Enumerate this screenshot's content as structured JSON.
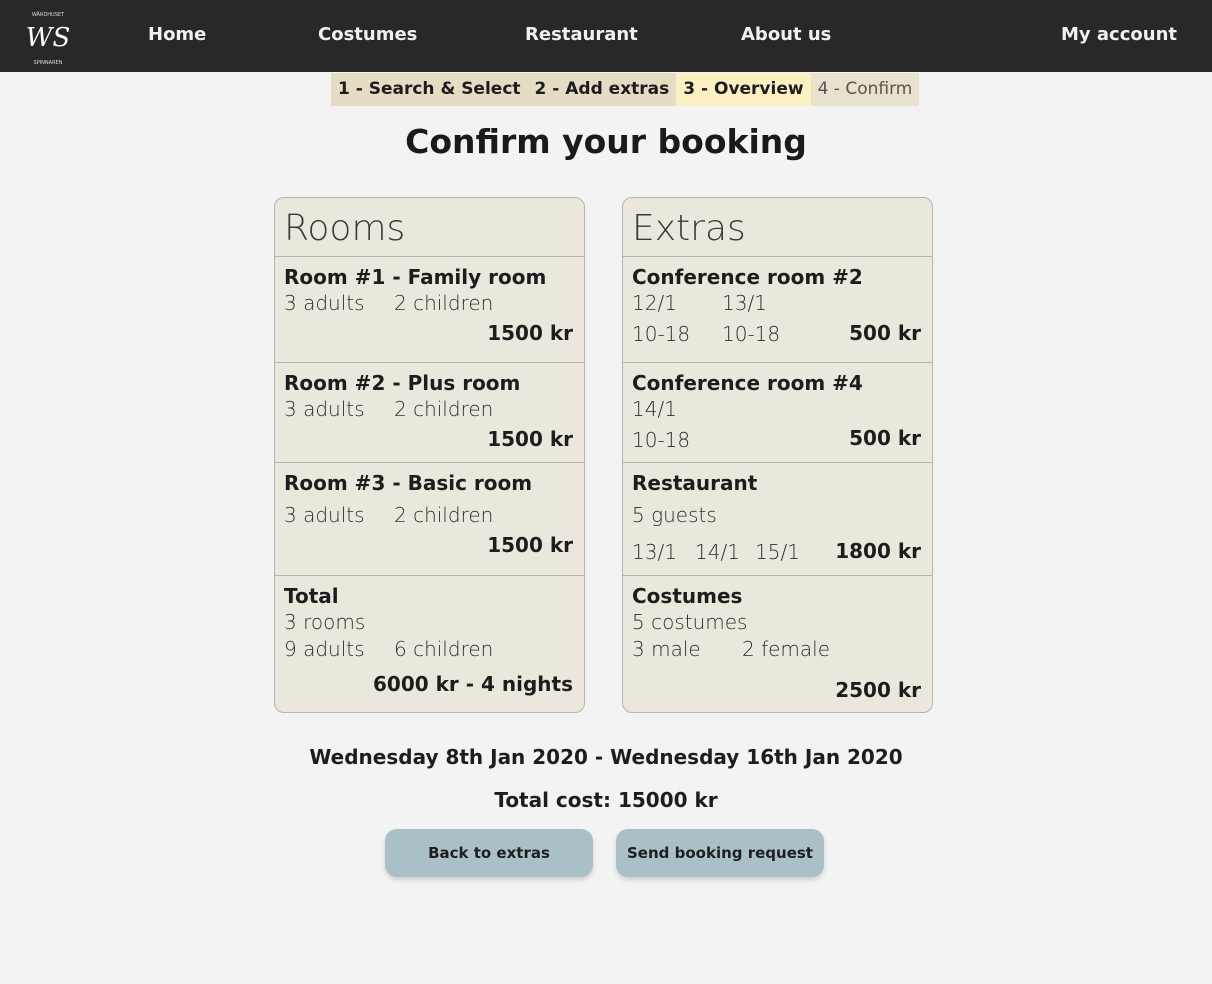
{
  "nav": {
    "logo_text": "WS",
    "logo_top_text": "WÄRDHUSET",
    "logo_bottom_text": "SPINNAREN",
    "links": [
      "Home",
      "Costumes",
      "Restaurant",
      "About us"
    ],
    "account": "My account"
  },
  "steps": [
    "1 - Search & Select",
    "2 - Add extras",
    "3 - Overview",
    "4 - Confirm"
  ],
  "title": "Confirm your booking",
  "rooms": {
    "heading": "Rooms",
    "items": [
      {
        "title": "Room #1 - Family room",
        "adults": "3 adults",
        "children": "2 children",
        "price": "1500 kr"
      },
      {
        "title": "Room #2 - Plus room",
        "adults": "3 adults",
        "children": "2 children",
        "price": "1500 kr"
      },
      {
        "title": "Room #3 - Basic room",
        "adults": "3 adults",
        "children": "2 children",
        "price": "1500 kr"
      }
    ],
    "total": {
      "title": "Total",
      "rooms": "3 rooms",
      "adults": "9 adults",
      "children": "6 children",
      "price": "6000 kr - 4 nights"
    }
  },
  "extras": {
    "heading": "Extras",
    "conf2": {
      "title": "Conference room #2",
      "dates": [
        "12/1",
        "13/1"
      ],
      "times": [
        "10-18",
        "10-18"
      ],
      "price": "500 kr"
    },
    "conf4": {
      "title": "Conference room #4",
      "dates": [
        "14/1"
      ],
      "times": [
        "10-18"
      ],
      "price": "500 kr"
    },
    "restaurant": {
      "title": "Restaurant",
      "guests": "5 guests",
      "dates": [
        "13/1",
        "14/1",
        "15/1"
      ],
      "price": "1800 kr"
    },
    "costumes": {
      "title": "Costumes",
      "count": "5 costumes",
      "male": "3 male",
      "female": "2 female",
      "price": "2500 kr"
    }
  },
  "date_range": "Wednesday 8th Jan 2020 - Wednesday 16th Jan 2020",
  "total_cost": "Total cost: 15000 kr",
  "buttons": {
    "back": "Back to extras",
    "send": "Send booking request"
  }
}
